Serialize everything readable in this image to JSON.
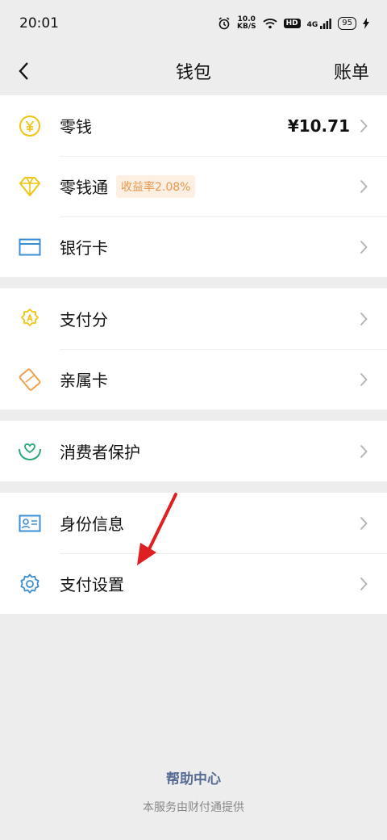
{
  "status_bar": {
    "time": "20:01",
    "net_speed_value": "10.0",
    "net_speed_unit": "KB/S",
    "hd": "HD",
    "network": "4G",
    "battery": "95"
  },
  "nav": {
    "title": "钱包",
    "right_label": "账单"
  },
  "groups": [
    {
      "items": [
        {
          "label": "零钱",
          "value": "¥10.71",
          "icon": "yen-coin-icon",
          "color": "#f1c40f"
        },
        {
          "label": "零钱通",
          "badge": "收益率2.08%",
          "icon": "diamond-icon",
          "color": "#f1c40f"
        },
        {
          "label": "银行卡",
          "icon": "bank-card-icon",
          "color": "#3a8fd4"
        }
      ]
    },
    {
      "items": [
        {
          "label": "支付分",
          "icon": "pay-score-icon",
          "color": "#f1c40f"
        },
        {
          "label": "亲属卡",
          "icon": "family-card-icon",
          "color": "#f0a04b"
        }
      ]
    },
    {
      "items": [
        {
          "label": "消费者保护",
          "icon": "consumer-protection-icon",
          "color": "#26a775"
        }
      ]
    },
    {
      "items": [
        {
          "label": "身份信息",
          "icon": "id-card-icon",
          "color": "#3a8fd4"
        },
        {
          "label": "支付设置",
          "icon": "gear-icon",
          "color": "#3a8fd4"
        }
      ]
    }
  ],
  "footer": {
    "help": "帮助中心",
    "provider": "本服务由财付通提供"
  },
  "colors": {
    "background": "#ededed",
    "link": "#576b95",
    "badge_bg": "#fdf0e2",
    "badge_text": "#e8974b",
    "annotation_arrow": "#e02020"
  }
}
